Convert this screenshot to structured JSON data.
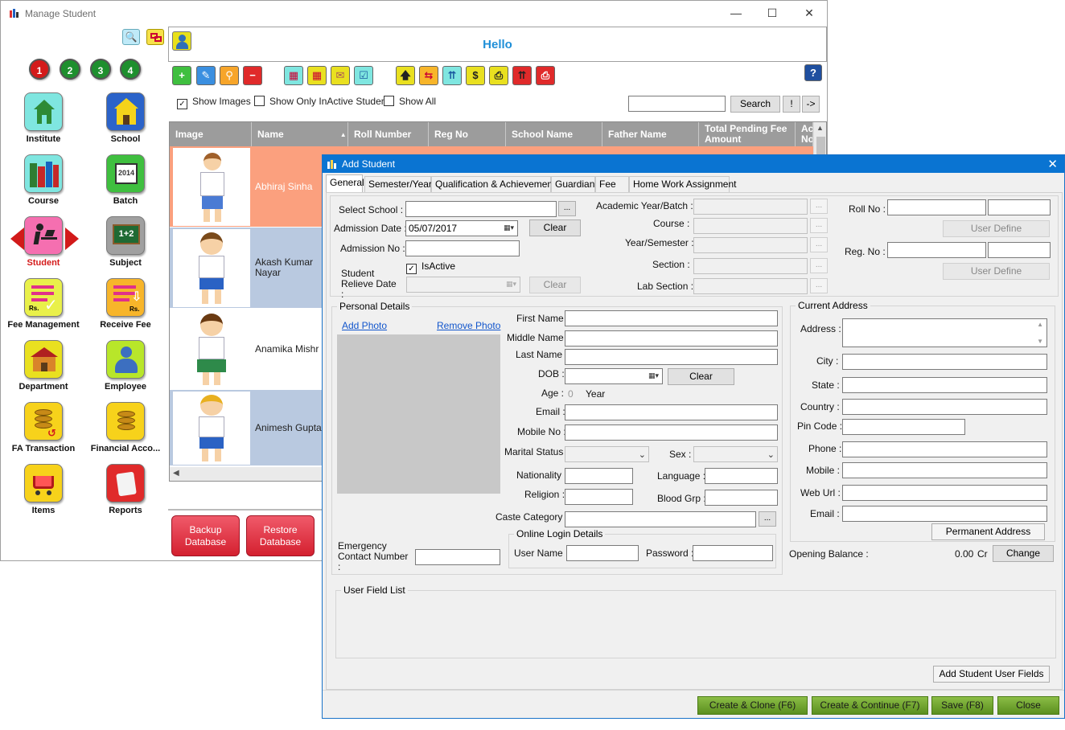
{
  "main_window": {
    "title": "Manage Student",
    "hello": "Hello",
    "nav_numbers": [
      "1",
      "2",
      "3",
      "4"
    ],
    "nav": [
      {
        "label": "Institute",
        "icon": "house-icon"
      },
      {
        "label": "School",
        "icon": "school-icon"
      },
      {
        "label": "Course",
        "icon": "books-icon"
      },
      {
        "label": "Batch",
        "icon": "calendar-icon"
      },
      {
        "label": "Student",
        "icon": "student-desk-icon"
      },
      {
        "label": "Subject",
        "icon": "chalkboard-icon"
      },
      {
        "label": "Fee Management",
        "icon": "fee-list-icon"
      },
      {
        "label": "Receive Fee",
        "icon": "receive-fee-icon"
      },
      {
        "label": "Department",
        "icon": "department-icon"
      },
      {
        "label": "Employee",
        "icon": "employee-icon"
      },
      {
        "label": "FA Transaction",
        "icon": "coins-icon"
      },
      {
        "label": "Financial Acco...",
        "icon": "coins-stack-icon"
      },
      {
        "label": "Items",
        "icon": "cart-icon"
      },
      {
        "label": "Reports",
        "icon": "scroll-icon"
      }
    ],
    "checkboxes": {
      "show_images": "Show Images",
      "show_inactive": "Show Only InActive Student",
      "show_all": "Show All"
    },
    "search_button": "Search",
    "bang_button": "!",
    "arrow_button": "->",
    "help_button": "?",
    "grid_headers": [
      "Image",
      "Name",
      "Roll Number",
      "Reg No",
      "School Name",
      "Father Name",
      "Total Pending Fee Amount",
      "Ac No"
    ],
    "grid_rows": [
      {
        "name": "Abhiraj Sinha"
      },
      {
        "name": "Akash Kumar Nayar"
      },
      {
        "name": "Anamika Mishr"
      },
      {
        "name": "Animesh Gupta"
      }
    ],
    "bottom_buttons": [
      "Backup Database",
      "Restore Database"
    ]
  },
  "dialog": {
    "title": "Add Student",
    "tabs": [
      "General",
      "Semester/Year",
      "Qualification & Achievements",
      "Guardian",
      "Fee",
      "Home Work Assignment"
    ],
    "labels": {
      "select_school": "Select School :",
      "admission_date": "Admission Date :",
      "admission_no": "Admission No :",
      "student_relieve_date": "Student Relieve Date :",
      "is_active": "IsActive",
      "academic_year": "Academic Year/Batch :",
      "course": "Course :",
      "year_semester": "Year/Semester :",
      "section": "Section :",
      "lab_section": "Lab Section :",
      "roll_no": "Roll No :",
      "reg_no": "Reg. No :",
      "personal_details": "Personal Details",
      "add_photo": "Add Photo",
      "remove_photo": "Remove Photo",
      "first_name": "First Name :",
      "middle_name": "Middle Name :",
      "last_name": "Last Name :",
      "dob": "DOB :",
      "age": "Age :",
      "age_value": "0",
      "age_unit": "Year",
      "email": "Email :",
      "mobile_no": "Mobile No :",
      "marital_status": "Marital Status :",
      "sex": "Sex :",
      "nationality": "Nationality :",
      "language": "Language :",
      "religion": "Religion :",
      "blood_grp": "Blood Grp :",
      "caste_category": "Caste Category :",
      "emergency_contact": "Emergency Contact Number :",
      "online_login": "Online Login Details",
      "user_name": "User Name :",
      "password": "Password :",
      "current_address": "Current Address",
      "address": "Address :",
      "city": "City :",
      "state": "State :",
      "country": "Country :",
      "pin_code": "Pin Code :",
      "phone": "Phone :",
      "mobile": "Mobile :",
      "web_url": "Web Url :",
      "addr_email": "Email :",
      "opening_balance": "Opening Balance :",
      "opening_balance_value": "0.00",
      "opening_balance_type": "Cr",
      "user_field_list": "User Field List"
    },
    "values": {
      "admission_date": "05/07/2017"
    },
    "buttons": {
      "ellipsis": "...",
      "clear": "Clear",
      "user_define": "User Define",
      "permanent_address": "Permanent Address",
      "change": "Change",
      "add_user_fields": "Add Student User Fields",
      "create_clone": "Create & Clone (F6)",
      "create_continue": "Create & Continue (F7)",
      "save": "Save (F8)",
      "close": "Close"
    }
  }
}
